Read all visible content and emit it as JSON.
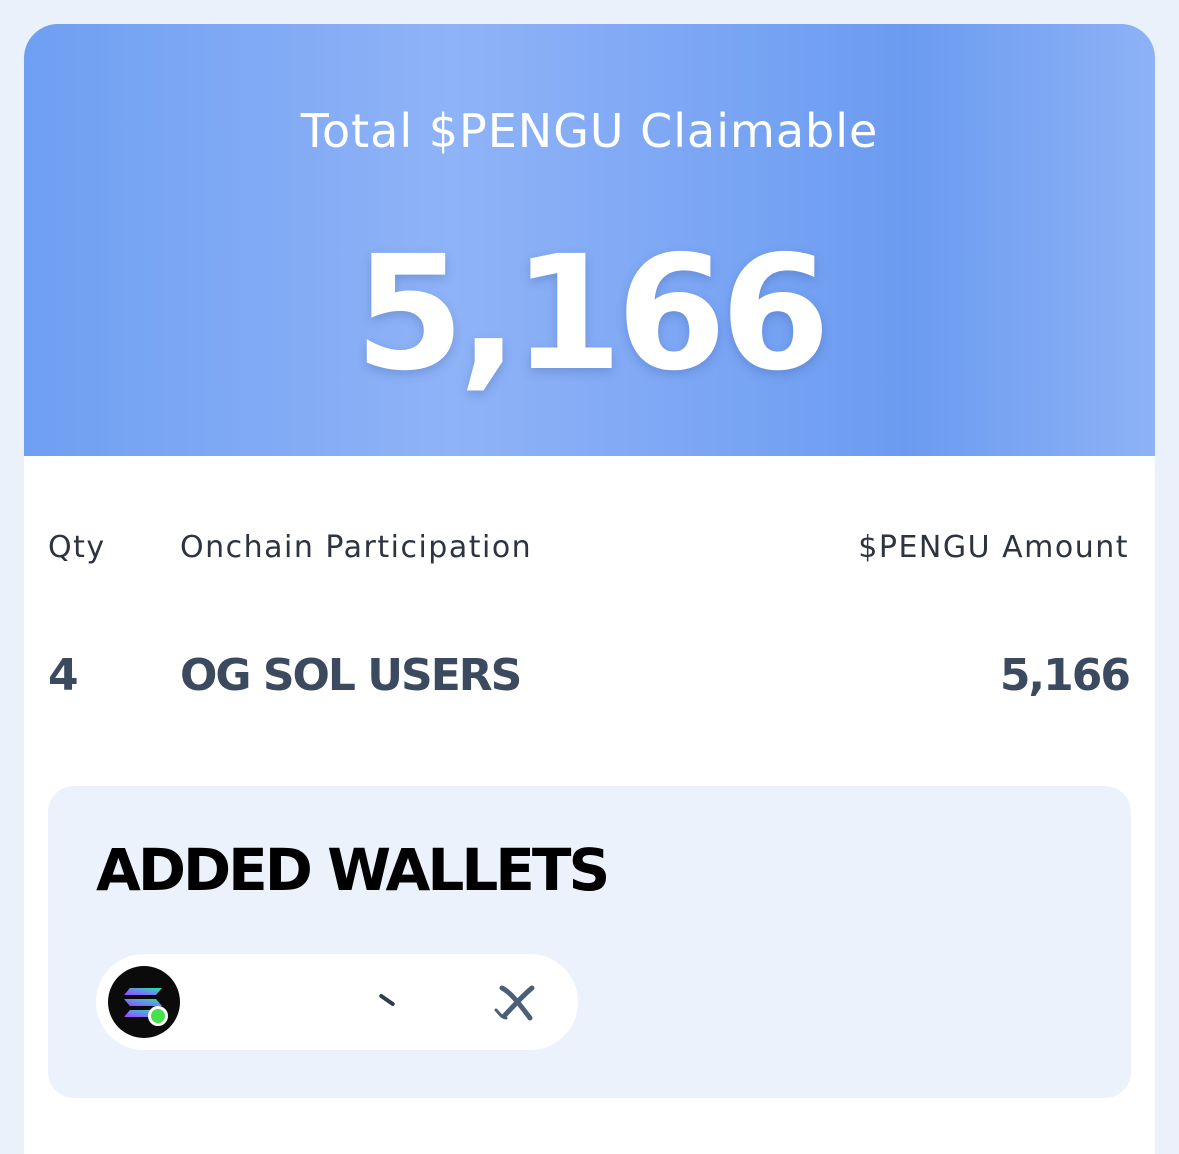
{
  "hero": {
    "title": "Total $PENGU Claimable",
    "amount": "5,166"
  },
  "table": {
    "headers": {
      "qty": "Qty",
      "participation": "Onchain Participation",
      "amount": "$PENGU Amount"
    },
    "rows": [
      {
        "qty": "4",
        "participation": "OG SOL USERS",
        "amount": "5,166"
      }
    ]
  },
  "wallets": {
    "title": "ADDED WALLETS",
    "items": [
      {
        "chain_icon": "solana-icon",
        "status": "connected",
        "status_color": "#46e04d",
        "address": "",
        "action_icon": "disconnect-icon"
      }
    ]
  },
  "colors": {
    "hero_gradient_start": "#6f9ff2",
    "hero_gradient_mid": "#8fb3f7",
    "text_dark": "#2d3440",
    "row_text": "#3c4a5f",
    "panel_bg": "#ecf2fc"
  }
}
